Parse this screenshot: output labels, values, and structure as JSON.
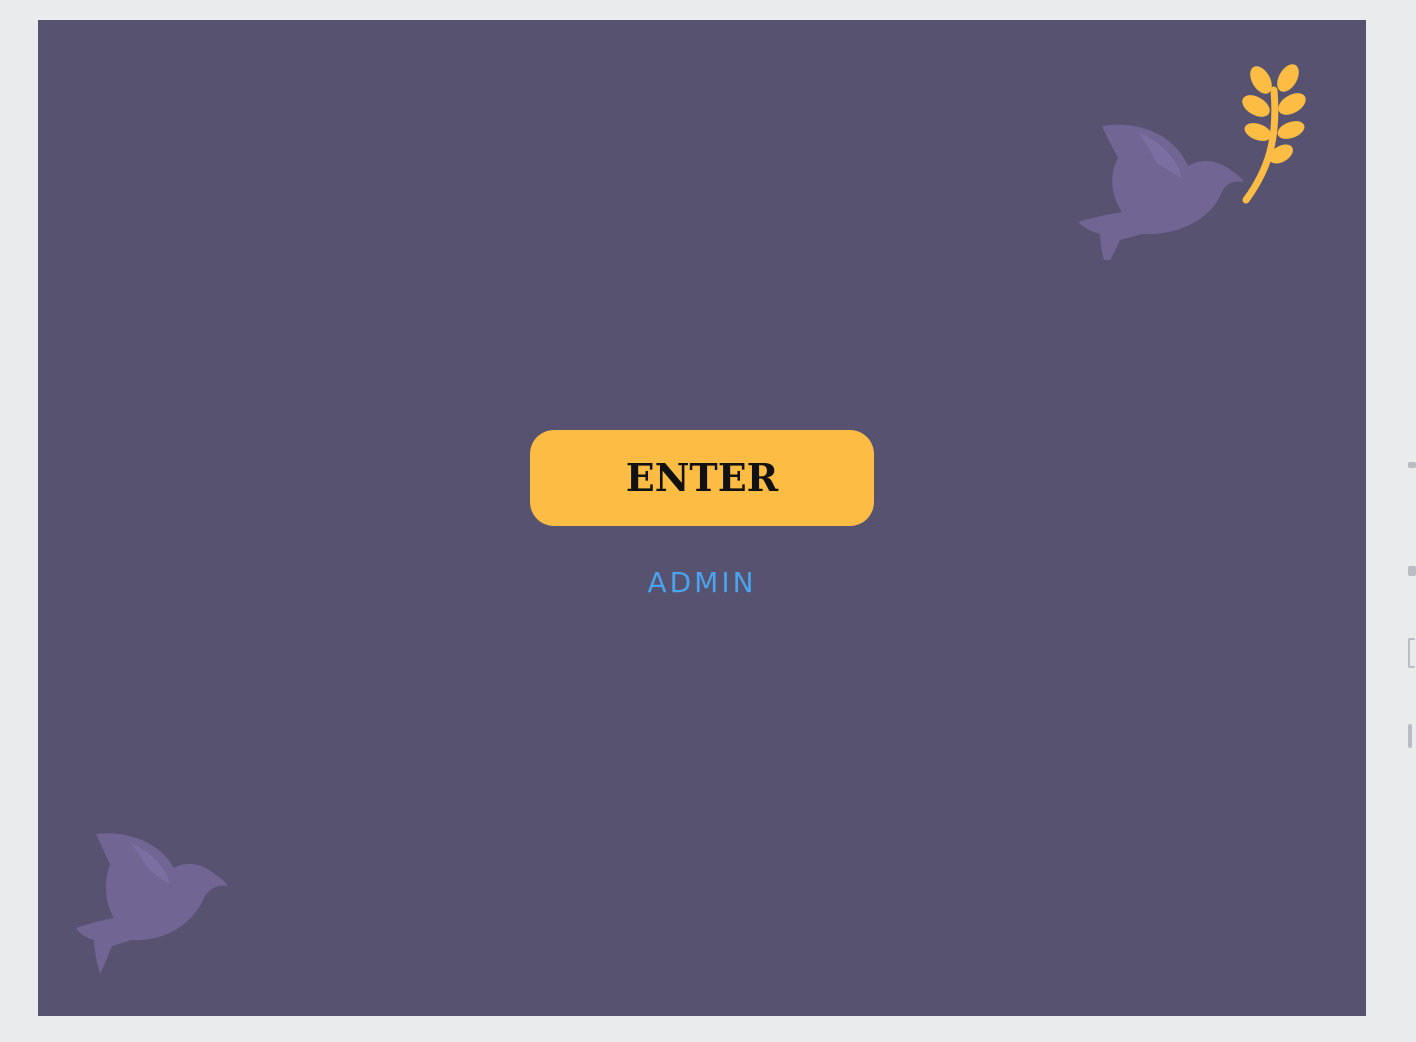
{
  "main": {
    "enter_label": "ENTER",
    "admin_label": "ADMIN"
  },
  "decor": {
    "top_dove_icon": "dove-with-olive-branch-icon",
    "bottom_dove_icon": "dove-icon"
  },
  "colors": {
    "background": "#575270",
    "dove": "#706593",
    "branch": "#fdbd44",
    "enter_button": "#fdbd44",
    "admin_link": "#4aa3ec",
    "page": "#eaebed"
  }
}
